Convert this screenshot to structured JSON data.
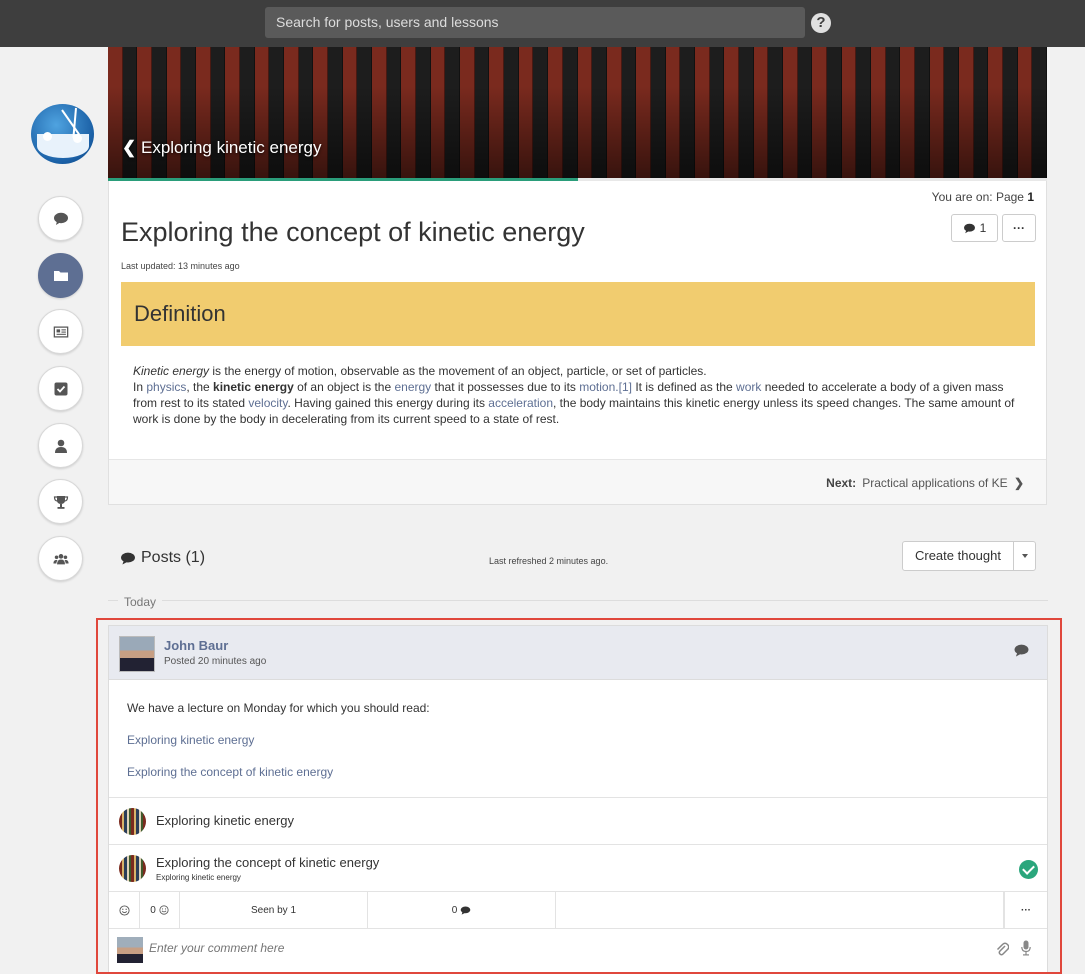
{
  "search": {
    "placeholder": "Search for posts, users and lessons"
  },
  "help_label": "?",
  "banner": {
    "back_label": "Exploring kinetic energy",
    "progress": 0.5
  },
  "page": {
    "location_prefix": "You are on: Page ",
    "location_page": "1",
    "comment_count": "1",
    "more_label": "···",
    "title": "Exploring the concept of kinetic energy",
    "updated": "Last updated: 13 minutes ago",
    "definition_heading": "Definition",
    "para1_em": "Kinetic energy",
    "para1_rest": " is the energy of motion, observable as the movement of an object, particle, or set of particles.",
    "p2_a": " In ",
    "p2_link_physics": "physics",
    "p2_b": ", the ",
    "p2_bold": "kinetic energy",
    "p2_c": " of an object is the ",
    "p2_link_energy": "energy",
    "p2_d": " that it possesses due to its ",
    "p2_link_motion": "motion",
    "p2_ref": ".[1]",
    "p2_e": " It is defined as the ",
    "p2_link_work": "work",
    "p2_f": " needed to accelerate a body of a given mass from rest to its stated ",
    "p2_link_velocity": "velocity",
    "p2_g": ". Having gained this energy during its ",
    "p2_link_acceleration": "acceleration",
    "p2_h": ", the body maintains this kinetic energy unless its speed changes. The same amount of work is done by the body in decelerating from its current speed to a state of rest.",
    "next_label": "Next:",
    "next_title": "Practical applications of KE"
  },
  "posts": {
    "title": "Posts (1)",
    "refreshed": "Last refreshed 2 minutes ago.",
    "create_label": "Create thought",
    "today_label": "Today"
  },
  "post": {
    "author": "John Baur",
    "posted": "Posted 20 minutes ago",
    "text": "We have a lecture on Monday for which you should read:",
    "link1": "Exploring kinetic energy",
    "link2": "Exploring the concept of kinetic energy",
    "attachments": [
      {
        "title": "Exploring kinetic energy",
        "subtitle": ""
      },
      {
        "title": "Exploring the concept of kinetic energy",
        "subtitle": "Exploring kinetic energy"
      }
    ],
    "reactions_count": "0",
    "seen_by": "Seen by 1",
    "comments_count": "0",
    "more_label": "···",
    "comment_placeholder": "Enter your comment here"
  },
  "colors": {
    "accent": "#5e6f93",
    "definition_bg": "#f1cc6f",
    "progress": "#2a9d7a",
    "highlight": "#e0473c",
    "check": "#2aa67c"
  }
}
